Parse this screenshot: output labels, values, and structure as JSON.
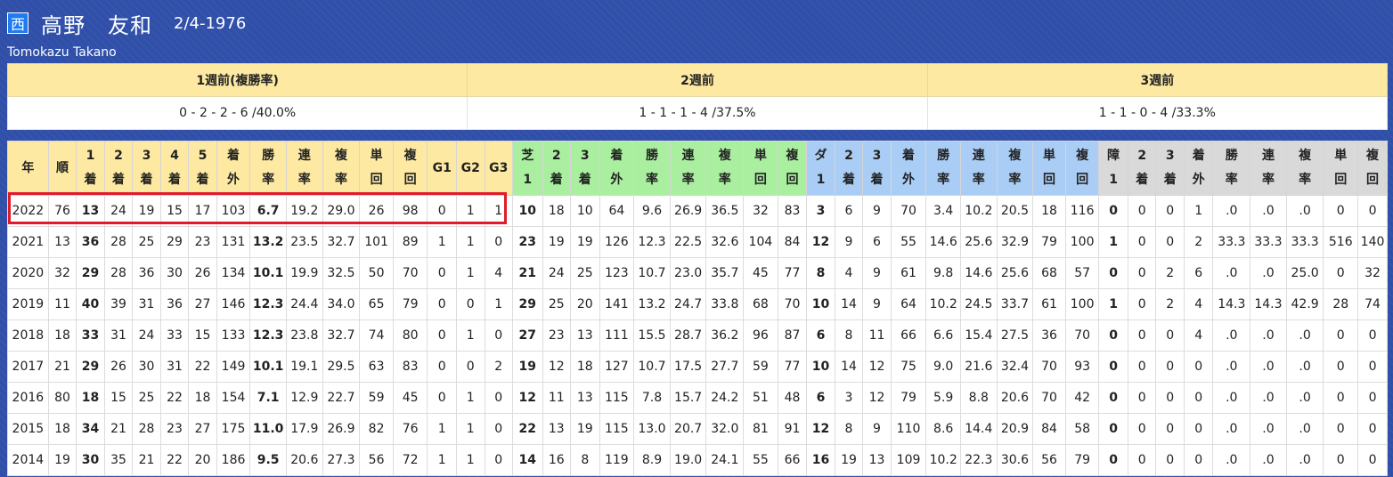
{
  "profile": {
    "region_badge": "西",
    "name": "高野　友和",
    "dob": "2/4-1976",
    "romaji": "Tomokazu Takano"
  },
  "weeks": {
    "headers": [
      "1週前(複勝率)",
      "2週前",
      "3週前"
    ],
    "values": [
      "0 - 2 - 2 - 6 /40.0%",
      "1 - 1 - 1 - 4 /37.5%",
      "1 - 1 - 0 - 4 /33.3%"
    ]
  },
  "stats": {
    "columns": [
      "年",
      "順",
      "1\n着",
      "2\n着",
      "3\n着",
      "4\n着",
      "5\n着",
      "着\n外",
      "勝\n率",
      "連\n率",
      "複\n率",
      "単\n回",
      "複\n回",
      "G1",
      "G2",
      "G3",
      "芝\n1",
      "2\n着",
      "3\n着",
      "着\n外",
      "勝\n率",
      "連\n率",
      "複\n率",
      "単\n回",
      "複\n回",
      "ダ\n1",
      "2\n着",
      "3\n着",
      "着\n外",
      "勝\n率",
      "連\n率",
      "複\n率",
      "単\n回",
      "複\n回",
      "障\n1",
      "2\n着",
      "3\n着",
      "着\n外",
      "勝\n率",
      "連\n率",
      "複\n率",
      "単\n回",
      "複\n回"
    ],
    "rows": [
      [
        "2022",
        "76",
        "13",
        "24",
        "19",
        "15",
        "17",
        "103",
        "6.7",
        "19.2",
        "29.0",
        "26",
        "98",
        "0",
        "1",
        "1",
        "10",
        "18",
        "10",
        "64",
        "9.6",
        "26.9",
        "36.5",
        "32",
        "83",
        "3",
        "6",
        "9",
        "70",
        "3.4",
        "10.2",
        "20.5",
        "18",
        "116",
        "0",
        "0",
        "0",
        "1",
        ".0",
        ".0",
        ".0",
        "0",
        "0"
      ],
      [
        "2021",
        "13",
        "36",
        "28",
        "25",
        "29",
        "23",
        "131",
        "13.2",
        "23.5",
        "32.7",
        "101",
        "89",
        "1",
        "1",
        "0",
        "23",
        "19",
        "19",
        "126",
        "12.3",
        "22.5",
        "32.6",
        "104",
        "84",
        "12",
        "9",
        "6",
        "55",
        "14.6",
        "25.6",
        "32.9",
        "79",
        "100",
        "1",
        "0",
        "0",
        "2",
        "33.3",
        "33.3",
        "33.3",
        "516",
        "140"
      ],
      [
        "2020",
        "32",
        "29",
        "28",
        "36",
        "30",
        "26",
        "134",
        "10.1",
        "19.9",
        "32.5",
        "50",
        "70",
        "0",
        "1",
        "4",
        "21",
        "24",
        "25",
        "123",
        "10.7",
        "23.0",
        "35.7",
        "45",
        "77",
        "8",
        "4",
        "9",
        "61",
        "9.8",
        "14.6",
        "25.6",
        "68",
        "57",
        "0",
        "0",
        "2",
        "6",
        ".0",
        ".0",
        "25.0",
        "0",
        "32"
      ],
      [
        "2019",
        "11",
        "40",
        "39",
        "31",
        "36",
        "27",
        "146",
        "12.3",
        "24.4",
        "34.0",
        "65",
        "79",
        "0",
        "0",
        "1",
        "29",
        "25",
        "20",
        "141",
        "13.2",
        "24.7",
        "33.8",
        "68",
        "70",
        "10",
        "14",
        "9",
        "64",
        "10.2",
        "24.5",
        "33.7",
        "61",
        "100",
        "1",
        "0",
        "2",
        "4",
        "14.3",
        "14.3",
        "42.9",
        "28",
        "74"
      ],
      [
        "2018",
        "18",
        "33",
        "31",
        "24",
        "33",
        "15",
        "133",
        "12.3",
        "23.8",
        "32.7",
        "74",
        "80",
        "0",
        "1",
        "0",
        "27",
        "23",
        "13",
        "111",
        "15.5",
        "28.7",
        "36.2",
        "96",
        "87",
        "6",
        "8",
        "11",
        "66",
        "6.6",
        "15.4",
        "27.5",
        "36",
        "70",
        "0",
        "0",
        "0",
        "4",
        ".0",
        ".0",
        ".0",
        "0",
        "0"
      ],
      [
        "2017",
        "21",
        "29",
        "26",
        "30",
        "31",
        "22",
        "149",
        "10.1",
        "19.1",
        "29.5",
        "63",
        "83",
        "0",
        "0",
        "2",
        "19",
        "12",
        "18",
        "127",
        "10.7",
        "17.5",
        "27.7",
        "59",
        "77",
        "10",
        "14",
        "12",
        "75",
        "9.0",
        "21.6",
        "32.4",
        "70",
        "93",
        "0",
        "0",
        "0",
        "0",
        ".0",
        ".0",
        ".0",
        "0",
        "0"
      ],
      [
        "2016",
        "80",
        "18",
        "15",
        "25",
        "22",
        "18",
        "154",
        "7.1",
        "12.9",
        "22.7",
        "59",
        "45",
        "0",
        "1",
        "0",
        "12",
        "11",
        "13",
        "115",
        "7.8",
        "15.7",
        "24.2",
        "51",
        "48",
        "6",
        "3",
        "12",
        "79",
        "5.9",
        "8.8",
        "20.6",
        "70",
        "42",
        "0",
        "0",
        "0",
        "0",
        ".0",
        ".0",
        ".0",
        "0",
        "0"
      ],
      [
        "2015",
        "18",
        "34",
        "21",
        "28",
        "23",
        "27",
        "175",
        "11.0",
        "17.9",
        "26.9",
        "82",
        "76",
        "1",
        "1",
        "0",
        "22",
        "13",
        "19",
        "115",
        "13.0",
        "20.7",
        "32.0",
        "81",
        "91",
        "12",
        "8",
        "9",
        "110",
        "8.6",
        "14.4",
        "20.9",
        "84",
        "58",
        "0",
        "0",
        "0",
        "0",
        ".0",
        ".0",
        ".0",
        "0",
        "0"
      ],
      [
        "2014",
        "19",
        "30",
        "35",
        "21",
        "22",
        "20",
        "186",
        "9.5",
        "20.6",
        "27.3",
        "56",
        "72",
        "1",
        "1",
        "0",
        "14",
        "16",
        "8",
        "119",
        "8.9",
        "19.0",
        "24.1",
        "55",
        "66",
        "16",
        "19",
        "13",
        "109",
        "10.2",
        "22.3",
        "30.6",
        "56",
        "79",
        "0",
        "0",
        "0",
        "0",
        ".0",
        ".0",
        ".0",
        "0",
        "0"
      ]
    ]
  },
  "colors": {
    "background": "#2f4fa8",
    "header_yellow": "#fde9a1",
    "header_green": "#a9ef9f",
    "header_blue": "#a9cdf5",
    "header_gray": "#d9d9d9",
    "highlight_red": "#e01b2a"
  }
}
